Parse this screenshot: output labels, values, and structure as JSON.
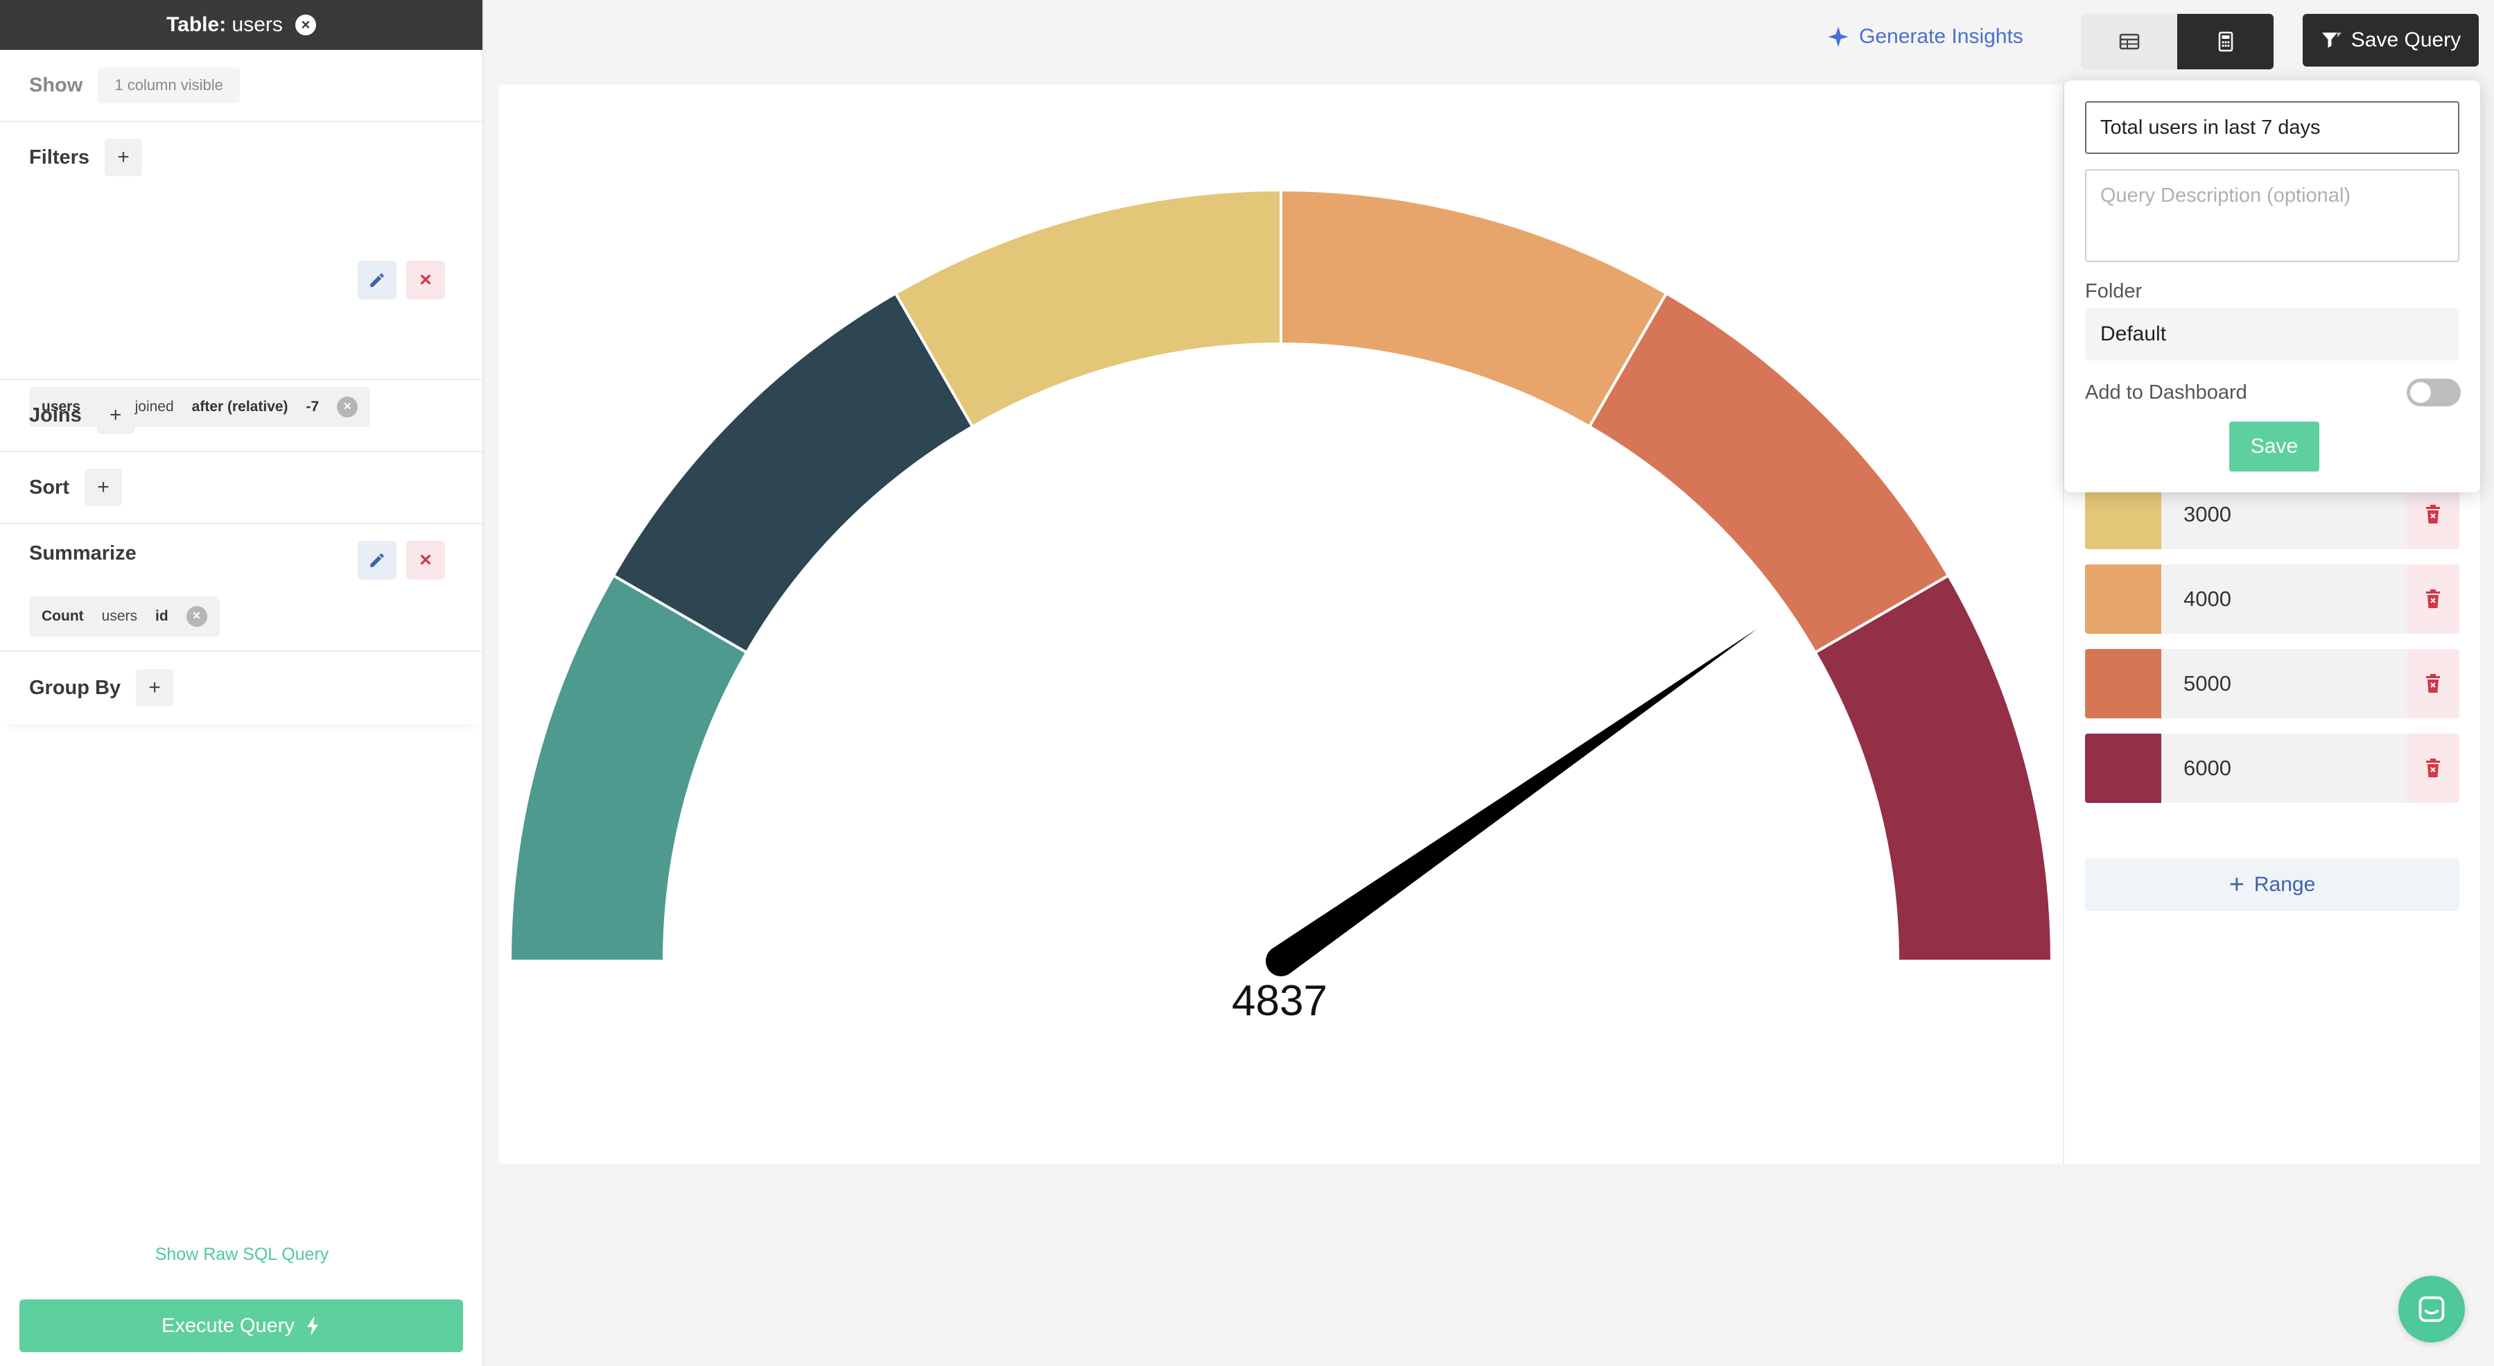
{
  "sidebar": {
    "table_prefix": "Table:",
    "table_name": "users",
    "show": {
      "title": "Show",
      "badge": "1 column visible"
    },
    "filters": {
      "title": "Filters",
      "plus": "+",
      "items": [
        {
          "table": "users",
          "column": "date_joined",
          "operator": "after (relative)",
          "value": "-7"
        }
      ]
    },
    "joins": {
      "title": "Joins",
      "plus": "+"
    },
    "sort": {
      "title": "Sort",
      "plus": "+"
    },
    "summarize": {
      "title": "Summarize",
      "items": [
        {
          "func": "Count",
          "table": "users",
          "column": "id"
        }
      ]
    },
    "group_by": {
      "title": "Group By",
      "plus": "+"
    },
    "raw_sql_link": "Show Raw SQL Query",
    "execute_label": "Execute Query"
  },
  "topbar": {
    "insights_label": "Generate Insights",
    "save_query_label": "Save Query"
  },
  "gauge": {
    "value": "4837",
    "colors": [
      "#4e9a8f",
      "#2e4552",
      "#e3c678",
      "#e8a56b",
      "#d77657",
      "#932f47"
    ]
  },
  "ranges": [
    {
      "value": "3000",
      "color": "#e3c678"
    },
    {
      "value": "4000",
      "color": "#e8a56b"
    },
    {
      "value": "5000",
      "color": "#d77657"
    },
    {
      "value": "6000",
      "color": "#932f47"
    }
  ],
  "add_range_label": "Range",
  "add_range_plus": "+",
  "save_popup": {
    "name_value": "Total users in last 7 days",
    "desc_placeholder": "Query Description (optional)",
    "folder_label": "Folder",
    "folder_value": "Default",
    "dashboard_label": "Add to Dashboard",
    "save_label": "Save"
  }
}
